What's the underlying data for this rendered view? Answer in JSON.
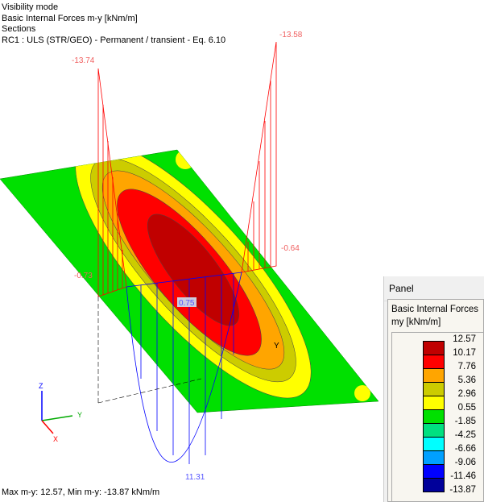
{
  "info": {
    "line1": "Visibility mode",
    "line2": "Basic Internal Forces m-y [kNm/m]",
    "line3": "Sections",
    "line4": "RC1 : ULS (STR/GEO) - Permanent / transient - Eq. 6.10"
  },
  "labels": {
    "top_left": "-13.74",
    "top_right": "-13.58",
    "left": "-0.73",
    "right": "-0.64",
    "mid": "0.75",
    "bottom": "11.31",
    "axis_y": "Y",
    "axis_z": "Z",
    "axis_x": "X",
    "plate_y": "Y"
  },
  "status": "Max m-y: 12.57, Min m-y: -13.87 kNm/m",
  "panel": {
    "title": "Panel",
    "heading": "Basic Internal Forces",
    "unit": "my [kNm/m]",
    "legend": [
      {
        "value": "12.57",
        "color": "#c00000"
      },
      {
        "value": "10.17",
        "color": "#ff0000"
      },
      {
        "value": "7.76",
        "color": "#ffa500"
      },
      {
        "value": "5.36",
        "color": "#cccc00"
      },
      {
        "value": "2.96",
        "color": "#ffff00"
      },
      {
        "value": "0.55",
        "color": "#00e000"
      },
      {
        "value": "-1.85",
        "color": "#00e080"
      },
      {
        "value": "-4.25",
        "color": "#00ffff"
      },
      {
        "value": "-6.66",
        "color": "#00a0ff"
      },
      {
        "value": "-9.06",
        "color": "#0000ff"
      },
      {
        "value": "-11.46",
        "color": "#00009a"
      },
      {
        "value": "-13.87",
        "color": ""
      }
    ]
  }
}
